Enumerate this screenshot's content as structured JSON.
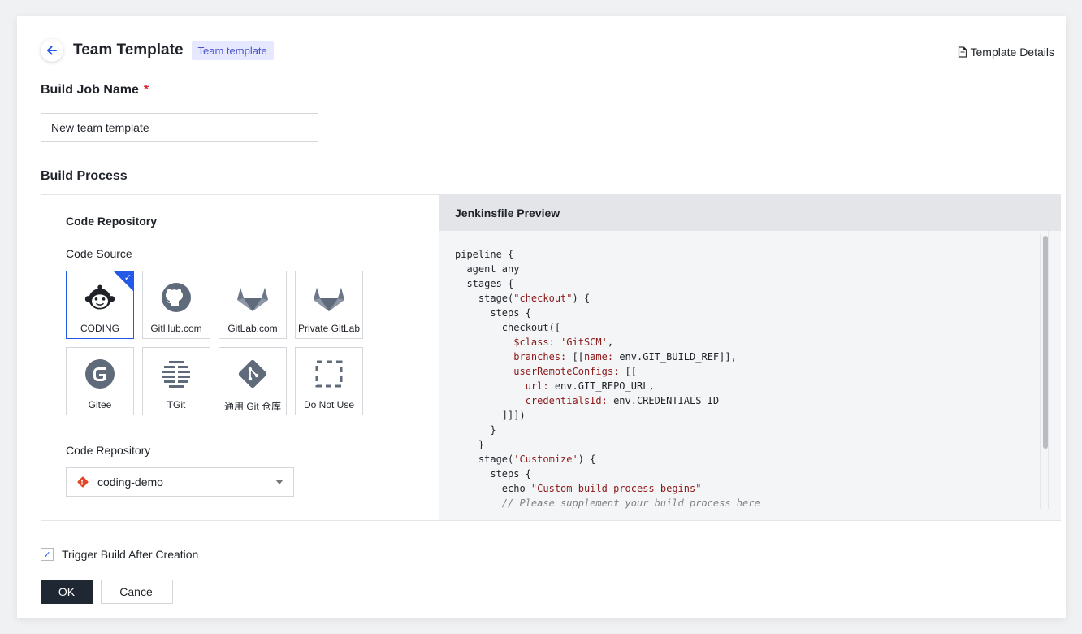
{
  "header": {
    "title": "Team Template",
    "badge": "Team template",
    "details_link": "Template Details"
  },
  "job_name": {
    "label": "Build Job Name",
    "required_mark": "*",
    "value": "New team template"
  },
  "build_process": {
    "label": "Build Process",
    "code_repository_title": "Code Repository",
    "code_source_label": "Code Source",
    "sources": [
      {
        "label": "CODING",
        "icon": "coding-monkey-icon",
        "selected": true
      },
      {
        "label": "GitHub.com",
        "icon": "github-icon",
        "selected": false
      },
      {
        "label": "GitLab.com",
        "icon": "gitlab-icon",
        "selected": false
      },
      {
        "label": "Private GitLab",
        "icon": "gitlab-icon",
        "selected": false
      },
      {
        "label": "Gitee",
        "icon": "gitee-icon",
        "selected": false
      },
      {
        "label": "TGit",
        "icon": "tgit-icon",
        "selected": false
      },
      {
        "label": "通用 Git 仓库",
        "icon": "git-icon",
        "selected": false
      },
      {
        "label": "Do Not Use",
        "icon": "dashed-square-icon",
        "selected": false
      }
    ],
    "repo_label": "Code Repository",
    "repo_value": "coding-demo"
  },
  "preview": {
    "title": "Jenkinsfile Preview"
  },
  "trigger": {
    "label": "Trigger Build After Creation",
    "checked": true
  },
  "actions": {
    "ok": "OK",
    "cancel": "Cance"
  },
  "colors": {
    "accent": "#2458e6",
    "primary_button": "#1f2733",
    "badge_bg": "#e6e8ff",
    "badge_text": "#4a55c9",
    "required": "#d9262b",
    "code_string": "#8b1a1a"
  }
}
